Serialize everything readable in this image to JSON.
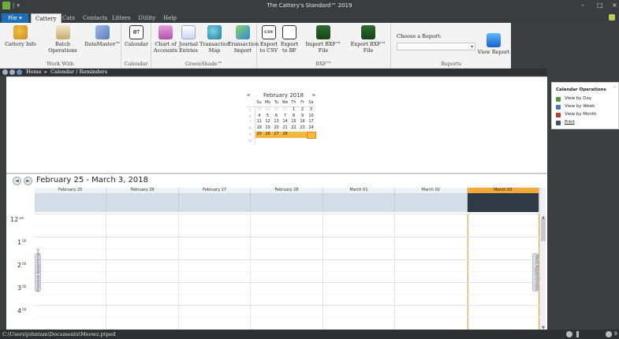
{
  "window": {
    "title": "The Cattery's Standard™ 2019",
    "controls": {
      "minimize": "–",
      "maximize": "□",
      "close": "×"
    }
  },
  "quick_access": {
    "separator": "|",
    "dropdown": "▾"
  },
  "menu": {
    "file_label": "File ▾",
    "tabs": [
      "Cattery",
      "Cats",
      "Contacts",
      "Litters",
      "Utility",
      "Help"
    ],
    "active_tab": "Cattery"
  },
  "ribbon": {
    "groups": {
      "work_with": "Work With",
      "calendar": "Calendar",
      "greenshade": "GreenShade™",
      "bxf": "BXF™",
      "reports": "Reports"
    },
    "buttons": {
      "cattery_info": "Cattery Info",
      "batch_operations": "Batch Operations",
      "datamaster": "DataMaster™",
      "calendar": "Calendar",
      "calendar_icon_text": "07",
      "chart_of_accounts_1": "Chart of",
      "chart_of_accounts_2": "Accounts",
      "journal_entries_1": "Journal",
      "journal_entries_2": "Entries",
      "transaction_map_1": "Transaction",
      "transaction_map_2": "Map",
      "transaction_import_1": "Transaction",
      "transaction_import_2": "Import",
      "export_csv_1": "Export",
      "export_csv_2": "to CSV",
      "export_bf_1": "Export",
      "export_bf_2": "to BF",
      "import_bxf": "Import BXF™ File",
      "export_bxf": "Export BXF™ File",
      "view_report": "View Report",
      "csv_icon_text": "CSV"
    },
    "report_label": "Choose a Report:",
    "report_value": ""
  },
  "breadcrumb": {
    "home": "Home",
    "separator": "▸",
    "current": "Calendar / Reminders"
  },
  "mini_calendar": {
    "title": "February 2018",
    "prev": "◄",
    "next": "►",
    "weekdays": [
      "Su",
      "Mo",
      "Tu",
      "We",
      "Th",
      "Fr",
      "Sa"
    ],
    "weeks": [
      {
        "wk": "5",
        "days": [
          "28",
          "29",
          "30",
          "31",
          "1",
          "2",
          "3"
        ]
      },
      {
        "wk": "6",
        "days": [
          "4",
          "5",
          "6",
          "7",
          "8",
          "9",
          "10"
        ]
      },
      {
        "wk": "7",
        "days": [
          "11",
          "12",
          "13",
          "14",
          "15",
          "16",
          "17"
        ]
      },
      {
        "wk": "8",
        "days": [
          "18",
          "19",
          "20",
          "21",
          "22",
          "23",
          "24"
        ]
      },
      {
        "wk": "9",
        "days": [
          "25",
          "26",
          "27",
          "28",
          "",
          "",
          ""
        ]
      },
      {
        "wk": "10",
        "days": [
          "",
          "",
          "",
          "",
          "",
          "",
          ""
        ]
      }
    ],
    "other_month_first_week": 4,
    "selected_week_index": 4
  },
  "calendar": {
    "range_title": "February 25 - March 3, 2018",
    "days": [
      "February 25",
      "February 26",
      "February 27",
      "February 28",
      "March 01",
      "March 02",
      "March 03"
    ],
    "today_index": 6,
    "hours": [
      {
        "h": "12",
        "s": "am"
      },
      {
        "h": "1",
        "s": "00"
      },
      {
        "h": "2",
        "s": "00"
      },
      {
        "h": "3",
        "s": "00"
      },
      {
        "h": "4",
        "s": "00"
      }
    ],
    "previous_appointment": "Previous Appointment",
    "next_appointment": "Next Appointment",
    "nav_prev": "◄",
    "nav_next": "►"
  },
  "operations_panel": {
    "title": "Calendar Operations",
    "close": "×",
    "items": [
      {
        "label": "View by Day",
        "color": "#4c9a3e"
      },
      {
        "label": "View by Week",
        "color": "#3f78c7"
      },
      {
        "label": "View by Month",
        "color": "#c23b2a"
      },
      {
        "label": "Print",
        "color": "#3d4c6e"
      }
    ]
  },
  "status": {
    "path": "C:\\Users\\johntam\\Documents\\Meowz.ptped",
    "zoom": "9"
  },
  "colors": {
    "accent": "#1d6fb8",
    "today": "#f2a93a",
    "dark_chrome": "#3c3f41"
  }
}
